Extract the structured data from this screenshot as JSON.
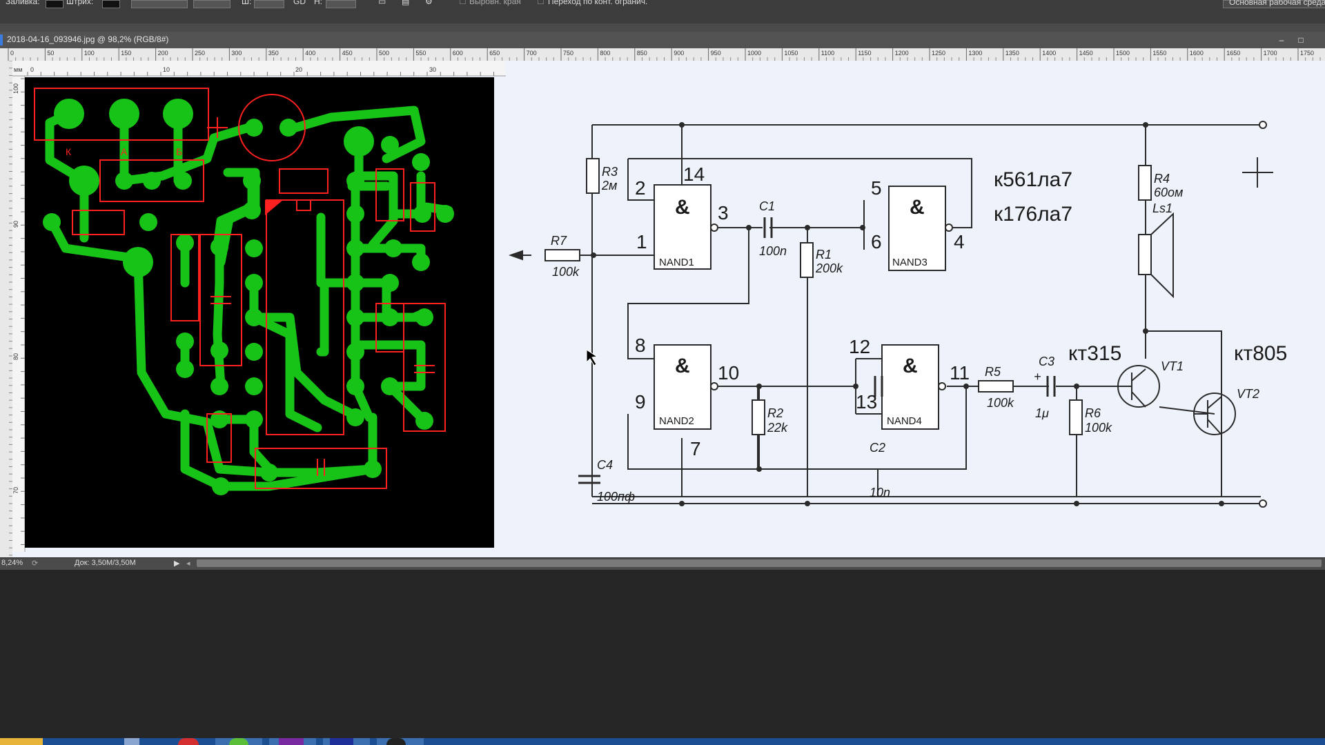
{
  "toolbar": {
    "options": [
      {
        "label": "Заливка:"
      },
      {
        "label": "Штрих:"
      },
      {
        "label": "Ш:"
      },
      {
        "label": "GD"
      },
      {
        "label": "H:"
      },
      {
        "label": "Выровн. края"
      },
      {
        "label": "Переход по конт. огранич."
      }
    ],
    "workspace_label": "Основная рабочая среда"
  },
  "document": {
    "title": "2018-04-16_093946.jpg @ 98,2% (RGB/8#)"
  },
  "ruler": {
    "unit": "мм",
    "top_ticks": [
      "0",
      "50",
      "100",
      "150",
      "200",
      "250",
      "300",
      "350",
      "400",
      "450",
      "500",
      "550",
      "600",
      "650",
      "700",
      "750",
      "800",
      "850",
      "900",
      "950",
      "1000",
      "1050",
      "1100",
      "1150",
      "1200",
      "1250",
      "1300",
      "1350",
      "1400",
      "1450",
      "1500",
      "1550",
      "1600",
      "1650",
      "1700",
      "1750"
    ],
    "image_ticks": [
      "0",
      "10",
      "20",
      "30"
    ],
    "left_ticks": [
      "100",
      "90",
      "80",
      "70"
    ]
  },
  "status": {
    "zoom": "8,24%",
    "doc_size": "Док: 3,50M/3,50M"
  },
  "schematic": {
    "chips": [
      "к561ла7",
      "к176ла7"
    ],
    "transistors": [
      "кт315",
      "кт805"
    ],
    "gates": [
      "NAND1",
      "NAND2",
      "NAND3",
      "NAND4"
    ],
    "gate_symbol": "&",
    "pins": [
      "1",
      "2",
      "3",
      "4",
      "5",
      "6",
      "7",
      "8",
      "9",
      "10",
      "11",
      "12",
      "13",
      "14"
    ],
    "components": {
      "R1": {
        "name": "R1",
        "value": "200k"
      },
      "R2": {
        "name": "R2",
        "value": "22k"
      },
      "R3": {
        "name": "R3",
        "value": "2м"
      },
      "R4": {
        "name": "R4",
        "value": "60ом"
      },
      "R5": {
        "name": "R5",
        "value": "100k"
      },
      "R6": {
        "name": "R6",
        "value": "100k"
      },
      "R7": {
        "name": "R7",
        "value": "100k"
      },
      "C1": {
        "name": "C1",
        "value": "100n"
      },
      "C2": {
        "name": "C2",
        "value": "10n"
      },
      "C3": {
        "name": "C3",
        "value": "1μ"
      },
      "C4": {
        "name": "C4",
        "value": "100пф"
      },
      "LS1": {
        "name": "Ls1"
      },
      "VT1": {
        "name": "VT1"
      },
      "VT2": {
        "name": "VT2"
      }
    },
    "plus": "+",
    "pcb_pads": [
      "К",
      "А",
      "Б"
    ]
  },
  "colors": {
    "pcb_background": "#000000",
    "pcb_copper": "#18c318",
    "pcb_silk": "#ff2020",
    "canvas": "#eef2fa",
    "wire": "#2a2a2a",
    "ui_dark": "#3c3c3c",
    "taskbar": "#1c4f92"
  }
}
